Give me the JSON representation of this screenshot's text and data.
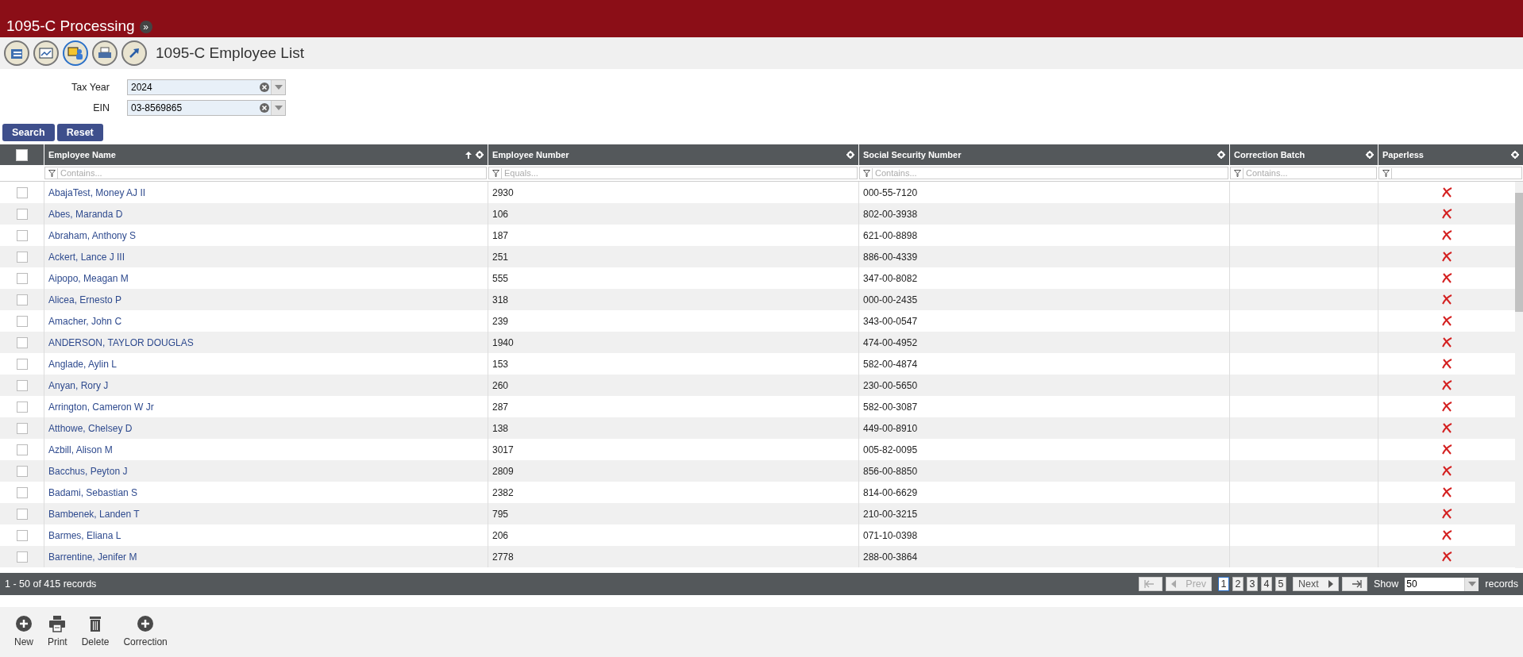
{
  "app": {
    "title": "1095-C Processing",
    "expand_glyph": "»"
  },
  "page": {
    "title": "1095-C Employee List"
  },
  "toolbar_icons": [
    {
      "kind": "documents",
      "selected": false
    },
    {
      "kind": "chart",
      "selected": false
    },
    {
      "kind": "person",
      "selected": true
    },
    {
      "kind": "printer",
      "selected": false
    },
    {
      "kind": "arrow",
      "selected": false
    }
  ],
  "filters": [
    {
      "label": "Tax Year",
      "value": "2024"
    },
    {
      "label": "EIN",
      "value": "03-8569865"
    }
  ],
  "actions": [
    "Search",
    "Reset"
  ],
  "table": {
    "select_all": {
      "checked": false
    },
    "columns": [
      {
        "label": "Employee Name",
        "filter_placeholder": "Contains...",
        "sort_ascending": true
      },
      {
        "label": "Employee Number",
        "filter_placeholder": "Equals..."
      },
      {
        "label": "Social Security Number",
        "filter_placeholder": "Contains..."
      },
      {
        "label": "Correction Batch",
        "filter_placeholder": "Contains..."
      },
      {
        "label": "Paperless"
      }
    ],
    "rows": [
      {
        "checked": false,
        "name": "AbajaTest, Money AJ II",
        "number": "2930",
        "ssn": "000-55-7120",
        "paperless": false
      },
      {
        "checked": false,
        "name": "Abes, Maranda D",
        "number": "106",
        "ssn": "802-00-3938",
        "paperless": false
      },
      {
        "checked": false,
        "name": "Abraham, Anthony S",
        "number": "187",
        "ssn": "621-00-8898",
        "paperless": false
      },
      {
        "checked": false,
        "name": "Ackert, Lance J III",
        "number": "251",
        "ssn": "886-00-4339",
        "paperless": false
      },
      {
        "checked": false,
        "name": "Aipopo, Meagan M",
        "number": "555",
        "ssn": "347-00-8082",
        "paperless": false
      },
      {
        "checked": false,
        "name": "Alicea, Ernesto P",
        "number": "318",
        "ssn": "000-00-2435",
        "paperless": false
      },
      {
        "checked": false,
        "name": "Amacher, John C",
        "number": "239",
        "ssn": "343-00-0547",
        "paperless": false
      },
      {
        "checked": false,
        "name": "ANDERSON, TAYLOR DOUGLAS",
        "number": "1940",
        "ssn": "474-00-4952",
        "paperless": false
      },
      {
        "checked": false,
        "name": "Anglade, Aylin L",
        "number": "153",
        "ssn": "582-00-4874",
        "paperless": false
      },
      {
        "checked": false,
        "name": "Anyan, Rory J",
        "number": "260",
        "ssn": "230-00-5650",
        "paperless": false
      },
      {
        "checked": false,
        "name": "Arrington, Cameron W Jr",
        "number": "287",
        "ssn": "582-00-3087",
        "paperless": false
      },
      {
        "checked": false,
        "name": "Atthowe, Chelsey D",
        "number": "138",
        "ssn": "449-00-8910",
        "paperless": false
      },
      {
        "checked": false,
        "name": "Azbill, Alison M",
        "number": "3017",
        "ssn": "005-82-0095",
        "paperless": false
      },
      {
        "checked": false,
        "name": "Bacchus, Peyton J",
        "number": "2809",
        "ssn": "856-00-8850",
        "paperless": false
      },
      {
        "checked": false,
        "name": "Badami, Sebastian S",
        "number": "2382",
        "ssn": "814-00-6629",
        "paperless": false
      },
      {
        "checked": false,
        "name": "Bambenek, Landen T",
        "number": "795",
        "ssn": "210-00-3215",
        "paperless": false
      },
      {
        "checked": false,
        "name": "Barmes, Eliana L",
        "number": "206",
        "ssn": "071-10-0398",
        "paperless": false
      },
      {
        "checked": false,
        "name": "Barrentine, Jenifer M",
        "number": "2778",
        "ssn": "288-00-3864",
        "paperless": false
      }
    ]
  },
  "pager": {
    "summary": "1 - 50 of 415 records",
    "prev": "Prev",
    "next": "Next",
    "prev_disabled": true,
    "next_disabled": false,
    "pages": [
      {
        "label": "1",
        "selected": true
      },
      {
        "label": "2",
        "selected": false
      },
      {
        "label": "3",
        "selected": false
      },
      {
        "label": "4",
        "selected": false
      },
      {
        "label": "5",
        "selected": false
      }
    ],
    "show_label": "Show",
    "page_size": "50",
    "records_label": "records"
  },
  "bottom_actions": [
    {
      "kind": "add",
      "label": "New"
    },
    {
      "kind": "print",
      "label": "Print"
    },
    {
      "kind": "delete",
      "label": "Delete"
    },
    {
      "kind": "add",
      "label": "Correction"
    }
  ]
}
